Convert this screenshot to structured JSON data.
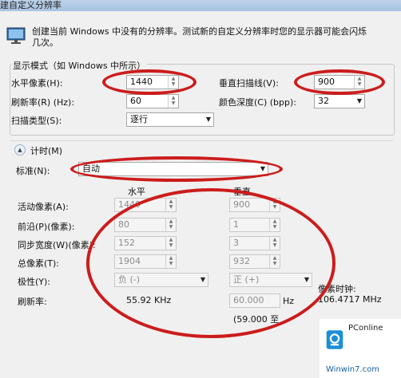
{
  "window": {
    "title": "建自定义分辨率"
  },
  "description": "创建当前 Windows 中没有的分辨率。测试新的自定义分辨率时您的显示器可能会闪烁几次。",
  "display_mode": {
    "group_label": "显示模式（如 Windows 中所示）",
    "h_pixels_label": "水平像素(H):",
    "h_pixels_value": "1440",
    "v_lines_label": "垂直扫描线(V):",
    "v_lines_value": "900",
    "refresh_label": "刷新率(R) (Hz):",
    "refresh_value": "60",
    "color_depth_label": "颜色深度(C) (bpp):",
    "color_depth_value": "32",
    "scan_type_label": "扫描类型(S):",
    "scan_type_value": "逐行"
  },
  "timing": {
    "section_label": "计时(M)",
    "standard_label": "标准(N):",
    "standard_value": "自动",
    "col_horizontal": "水平",
    "col_vertical": "垂直",
    "rows": [
      {
        "label": "活动像素(A):",
        "h": "1440",
        "v": "900"
      },
      {
        "label": "前沿(P)(像素):",
        "h": "80",
        "v": "1"
      },
      {
        "label": "同步宽度(W)(像素):",
        "h": "152",
        "v": "3"
      },
      {
        "label": "总像素(T):",
        "h": "1904",
        "v": "932"
      }
    ],
    "polarity_label": "极性(Y):",
    "polarity_h": "负 (-)",
    "polarity_v": "正 (+)",
    "refresh_label": "刷新率:",
    "refresh_h": "55.92 KHz",
    "refresh_v": "60.000",
    "refresh_v_unit": "Hz",
    "pixel_clock_label": "像素时钟:",
    "pixel_clock_value": "106.4717 MHz",
    "note": "(59.000 至"
  },
  "watermark": {
    "brand": "PConline",
    "site": "Winwin7.com"
  },
  "colors": {
    "annotation": "#cc1c1c"
  }
}
